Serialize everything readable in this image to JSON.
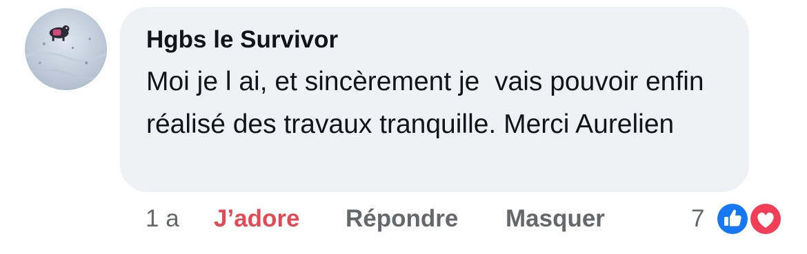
{
  "comment": {
    "author": "Hgbs le Survivor",
    "text": "Moi je l ai, et sincèrement je  vais pouvoir enfin réalisé des travaux tranquille. Merci Aurelien",
    "avatar_icon": "profile-photo-dog-in-snow"
  },
  "actions": {
    "timestamp": "1 a",
    "love_label": "J’adore",
    "reply_label": "Répondre",
    "hide_label": "Masquer"
  },
  "reactions": {
    "count": "7",
    "types": [
      "like-icon",
      "love-icon"
    ]
  },
  "colors": {
    "bubble": "#eff1f4",
    "text": "#111418",
    "muted": "#65676b",
    "love_active": "#e34a55",
    "like_blue": "#1877f2",
    "love_red": "#f33e58"
  }
}
